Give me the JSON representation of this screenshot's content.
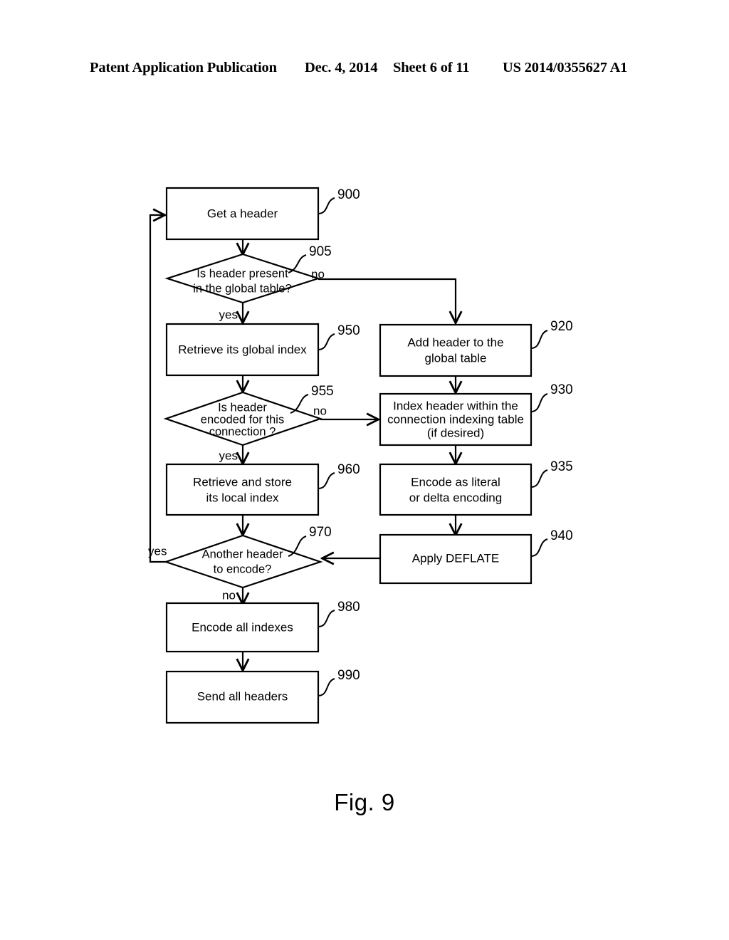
{
  "page_header": {
    "publication": "Patent Application Publication",
    "date": "Dec. 4, 2014",
    "sheet": "Sheet 6 of 11",
    "patent_number": "US 2014/0355627 A1"
  },
  "figure": {
    "caption": "Fig. 9"
  },
  "flowchart": {
    "nodes": {
      "n900": {
        "ref": "900",
        "type": "process",
        "text_lines": [
          "Get a header"
        ]
      },
      "n905": {
        "ref": "905",
        "type": "decision",
        "text_lines": [
          "Is header present",
          "in the global table?"
        ]
      },
      "n950": {
        "ref": "950",
        "type": "process",
        "text_lines": [
          "Retrieve its global index"
        ]
      },
      "n920": {
        "ref": "920",
        "type": "process",
        "text_lines": [
          "Add header to the",
          "global table"
        ]
      },
      "n955": {
        "ref": "955",
        "type": "decision",
        "text_lines": [
          "Is header",
          "encoded for this",
          "connection ?"
        ]
      },
      "n930": {
        "ref": "930",
        "type": "process",
        "text_lines": [
          "Index header within the",
          "connection indexing table",
          "(if desired)"
        ]
      },
      "n960": {
        "ref": "960",
        "type": "process",
        "text_lines": [
          "Retrieve and store",
          "its local index"
        ]
      },
      "n935": {
        "ref": "935",
        "type": "process",
        "text_lines": [
          "Encode as literal",
          "or delta encoding"
        ]
      },
      "n970": {
        "ref": "970",
        "type": "decision",
        "text_lines": [
          "Another header",
          "to encode?"
        ]
      },
      "n940": {
        "ref": "940",
        "type": "process",
        "text_lines": [
          "Apply DEFLATE"
        ]
      },
      "n980": {
        "ref": "980",
        "type": "process",
        "text_lines": [
          "Encode all indexes"
        ]
      },
      "n990": {
        "ref": "990",
        "type": "process",
        "text_lines": [
          "Send all headers"
        ]
      }
    },
    "edge_labels": {
      "e905_no": "no",
      "e905_yes": "yes",
      "e955_no": "no",
      "e955_yes": "yes",
      "e970_yes": "yes",
      "e970_no": "no"
    }
  }
}
